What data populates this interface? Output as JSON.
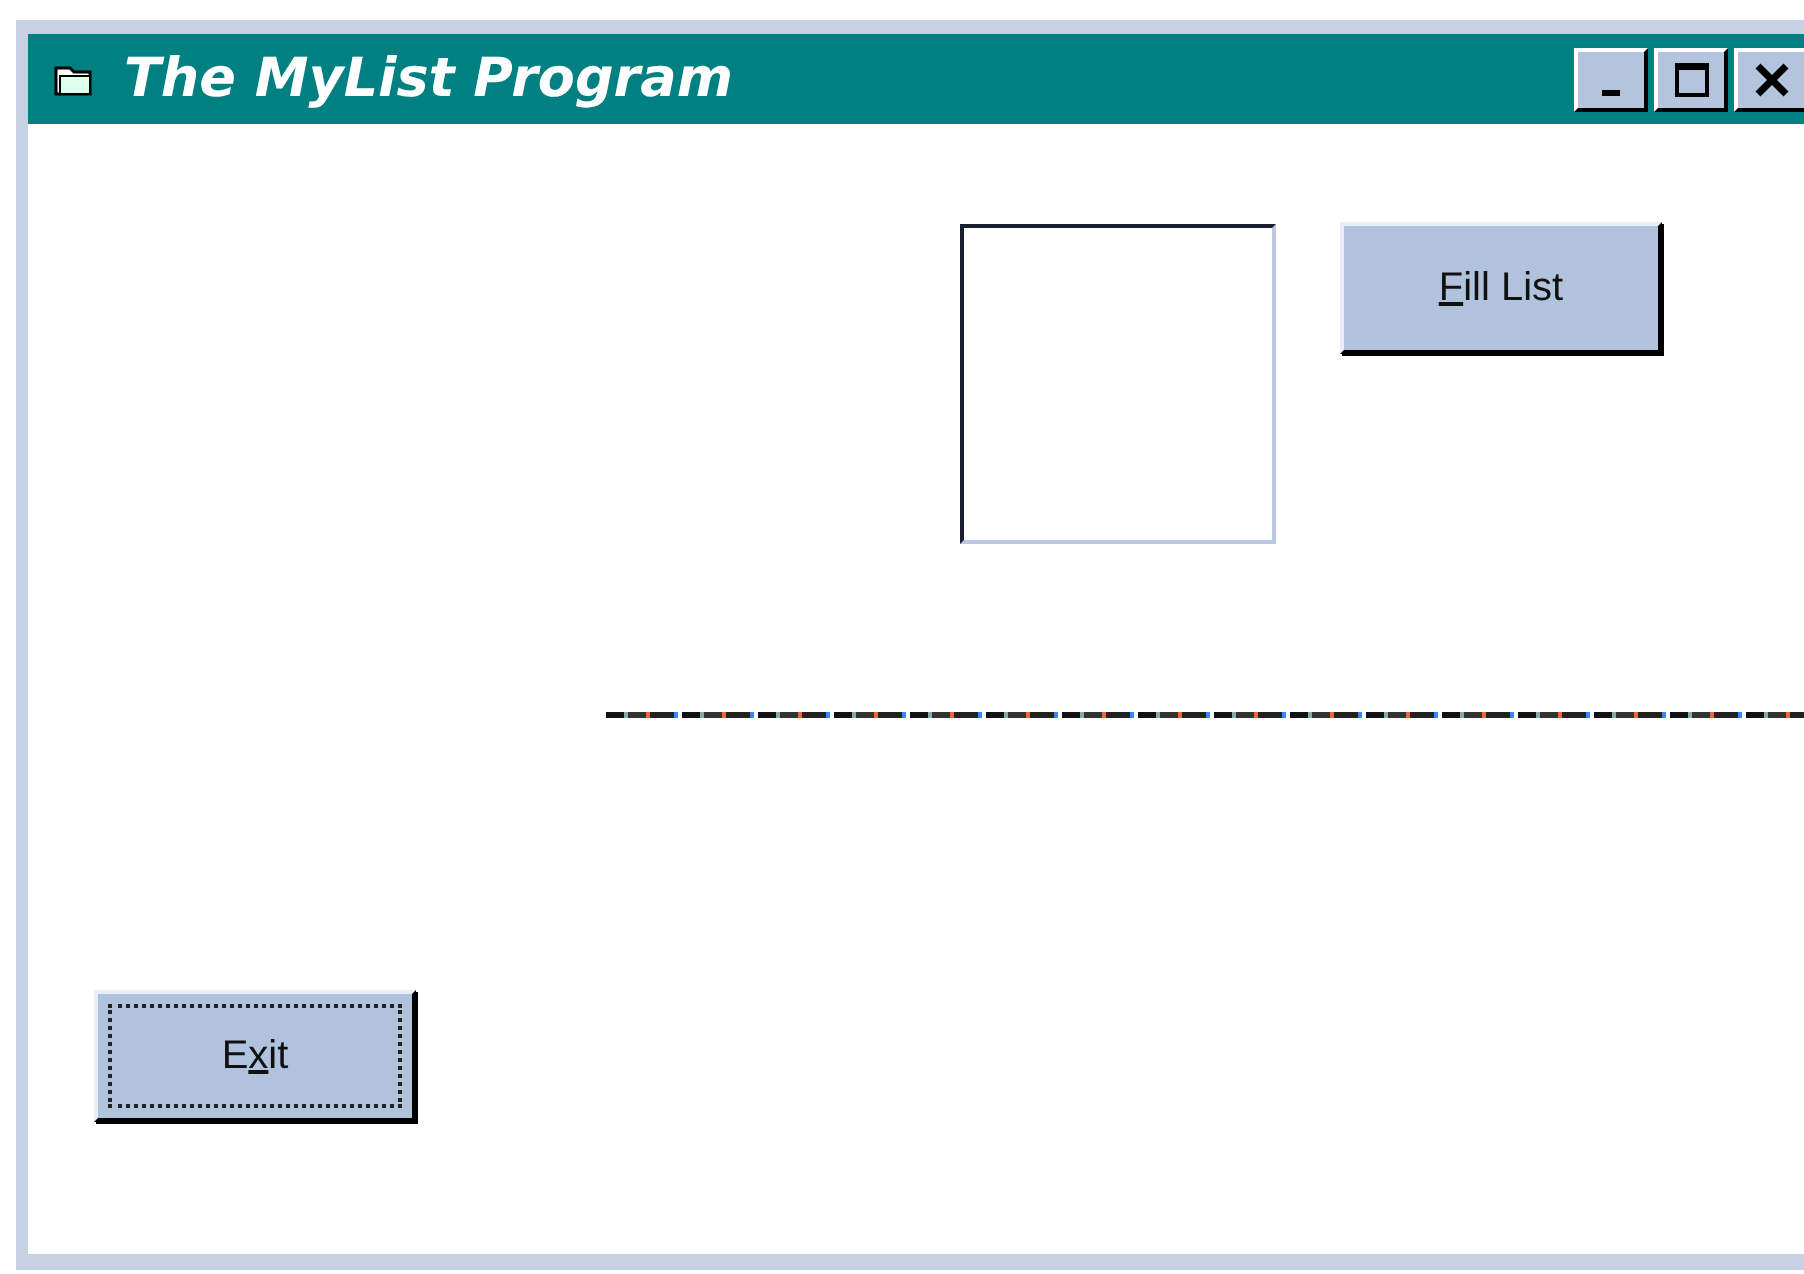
{
  "window": {
    "title": "The MyList Program"
  },
  "title_buttons": [
    {
      "kind": "minimize"
    },
    {
      "kind": "maximize"
    },
    {
      "kind": "close"
    }
  ],
  "list_box": {
    "kind": "empty"
  },
  "buttons": [
    {
      "kind": "fill",
      "label_parts": [
        {
          "text": "F",
          "underlined": true
        },
        {
          "text": "ill List",
          "underlined": false
        }
      ],
      "focused": false
    },
    {
      "kind": "exit",
      "label_parts": [
        {
          "text": "E",
          "underlined": false
        },
        {
          "text": "x",
          "underlined": true
        },
        {
          "text": "it",
          "underlined": false
        }
      ],
      "focused": true
    }
  ]
}
